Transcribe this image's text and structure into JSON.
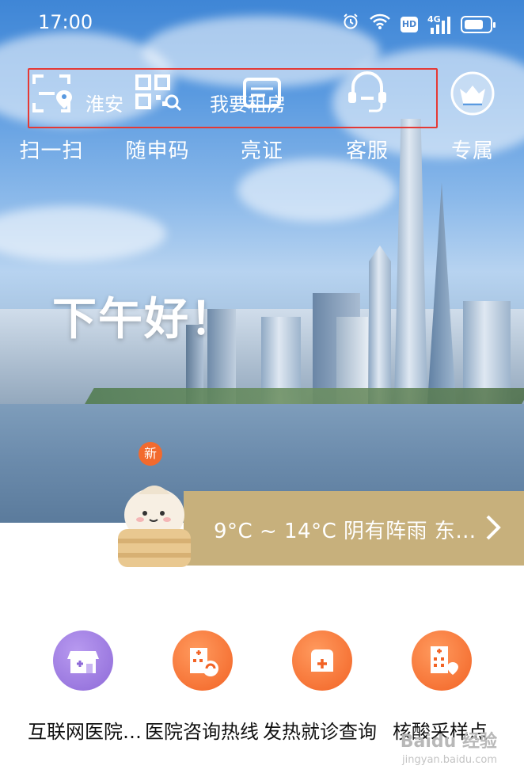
{
  "status_bar": {
    "time": "17:00",
    "icons": [
      "alarm-icon",
      "wifi-icon",
      "hd-icon",
      "signal-4g-icon",
      "battery-icon"
    ],
    "hd_label": "HD",
    "network_label": "4G",
    "battery_level": 0.75
  },
  "quick_actions": [
    {
      "label": "扫一扫",
      "icon": "scan-icon"
    },
    {
      "label": "随申码",
      "icon": "qr-code-icon"
    },
    {
      "label": "亮证",
      "icon": "id-card-icon"
    },
    {
      "label": "客服",
      "icon": "customer-service-icon"
    },
    {
      "label": "专属",
      "icon": "crown-icon"
    }
  ],
  "overlay": {
    "location": "淮安",
    "search_text": "我要租房"
  },
  "greeting": "下午好！",
  "badge_new": "新",
  "weather": {
    "text": "9°C ~ 14°C  阴有阵雨  东…"
  },
  "services": [
    {
      "label": "互联网医院…",
      "icon": "clinic-store-icon",
      "color": "#8e6ad8"
    },
    {
      "label": "医院咨询热线",
      "icon": "hospital-phone-icon",
      "color": "#f36b2c"
    },
    {
      "label": "发热就诊查询",
      "icon": "medical-box-icon",
      "color": "#f36b2c"
    },
    {
      "label": "核酸采样点",
      "icon": "hospital-location-icon",
      "color": "#f36b2c"
    }
  ],
  "watermark": {
    "brand": "Baidu 经验",
    "url": "jingyan.baidu.com"
  },
  "colors": {
    "weather_banner": "#c7b07c",
    "highlight_box": "#e53935",
    "orange": "#f36b2c",
    "purple": "#8e6ad8"
  }
}
